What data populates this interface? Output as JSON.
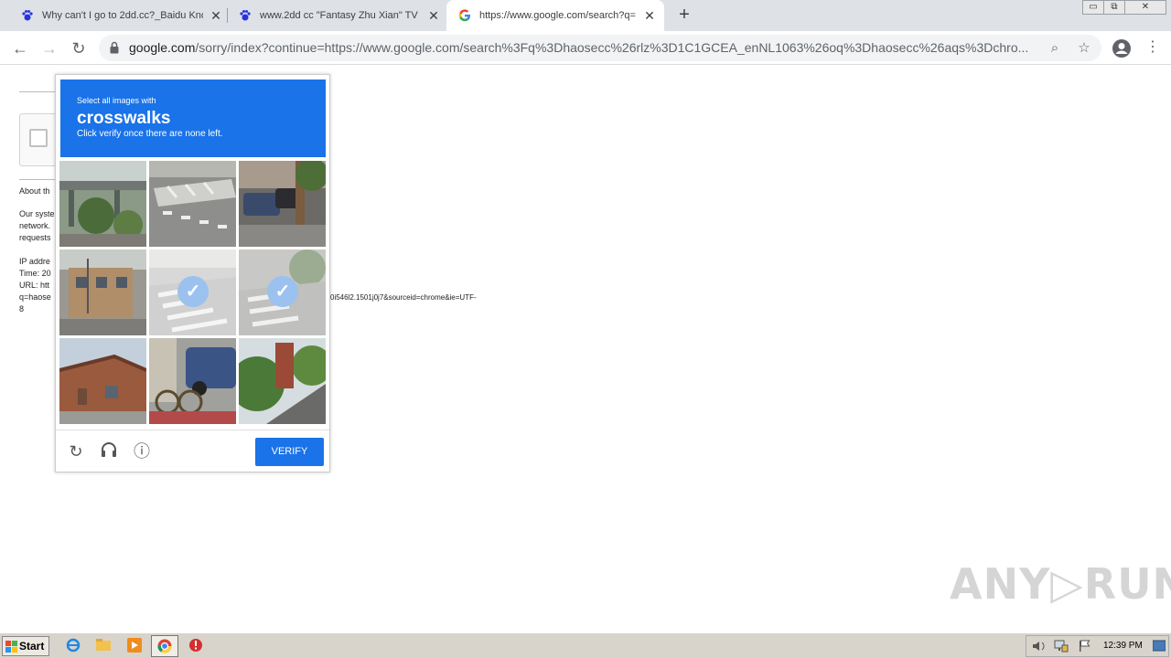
{
  "tabs": [
    {
      "title": "Why can't I go to 2dd.cc?_Baidu Kno",
      "icon": "baidu-paw-icon",
      "active": false
    },
    {
      "title": "www.2dd cc \"Fantasy Zhu Xian\" TV s",
      "icon": "baidu-paw-icon",
      "active": false
    },
    {
      "title": "https://www.google.com/search?q=",
      "icon": "google-g-icon",
      "active": true
    }
  ],
  "new_tab_label": "+",
  "window_controls": {
    "minimize": "▭",
    "restore": "⧉",
    "close": "✕"
  },
  "toolbar": {
    "back": "←",
    "forward": "→",
    "reload": "↻",
    "url_host": "google.com",
    "url_path": "/sorry/index?continue=https://www.google.com/search%3Fq%3Dhaosecc%26rlz%3D1C1GCEA_enNL1063%26oq%3Dhaosecc%26aqs%3Dchro...",
    "zoom_icon": "⌕",
    "star_icon": "☆",
    "menu_icon": "⋮"
  },
  "background_page": {
    "about": "About th",
    "system_lines": [
      "Our syste",
      "network.",
      "requests"
    ],
    "info_lines": [
      "IP addre",
      "Time: 20",
      "URL: htt",
      "q=haose",
      "8"
    ],
    "url_tail": "0i546l2.1501j0j7&sourceid=chrome&ie=UTF-"
  },
  "captcha": {
    "instruction_small": "Select all images with",
    "target_word": "crosswalks",
    "instruction_sub": "Click verify once there are none left.",
    "check_mark": "✓",
    "tiles": [
      {
        "scene": "overpass-trees",
        "selected": false
      },
      {
        "scene": "road-crosswalk",
        "selected": false
      },
      {
        "scene": "parked-cars-tree",
        "selected": false
      },
      {
        "scene": "building-street",
        "selected": false
      },
      {
        "scene": "crosswalk",
        "selected": true
      },
      {
        "scene": "crosswalk-bushes",
        "selected": true
      },
      {
        "scene": "brick-house",
        "selected": false
      },
      {
        "scene": "bicycle-car",
        "selected": false
      },
      {
        "scene": "brick-chimney-tree",
        "selected": false
      }
    ],
    "reload_icon": "↻",
    "audio_icon": "🎧",
    "info_icon": "ⓘ",
    "verify_label": "VERIFY"
  },
  "watermark": "ANY▷RUN",
  "taskbar": {
    "start_label": "Start",
    "clock": "12:39 PM"
  },
  "colors": {
    "captcha_blue": "#1a73e8",
    "tab_strip": "#dee1e6",
    "taskbar": "#d8d4cc"
  }
}
